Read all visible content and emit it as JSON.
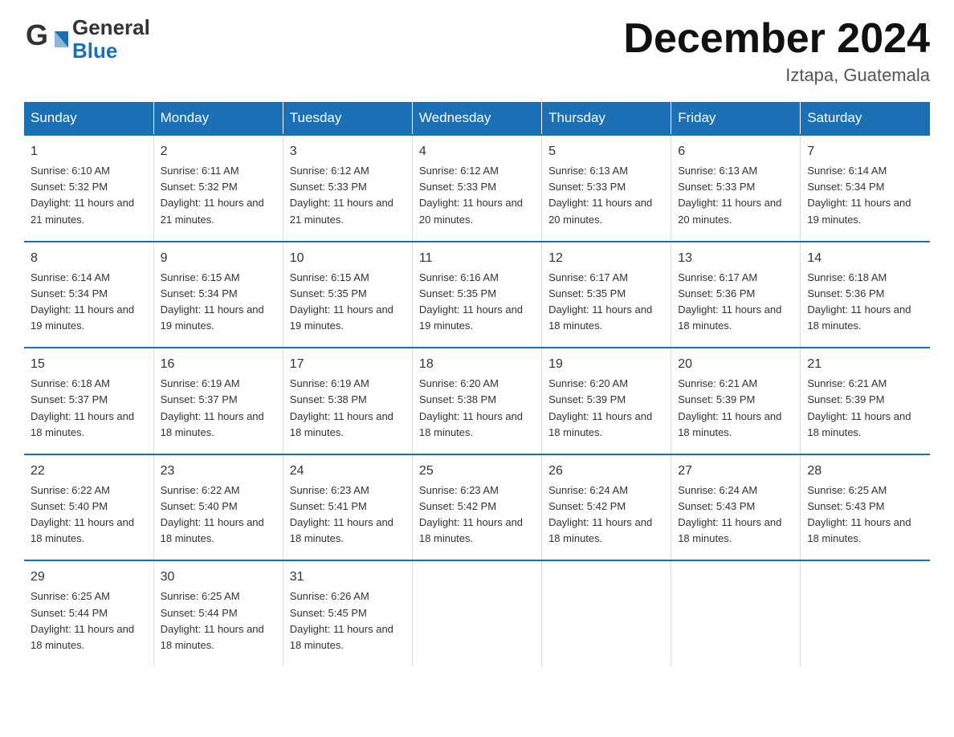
{
  "header": {
    "logo_line1": "General",
    "logo_line2": "Blue",
    "main_title": "December 2024",
    "subtitle": "Iztapa, Guatemala"
  },
  "days_of_week": [
    "Sunday",
    "Monday",
    "Tuesday",
    "Wednesday",
    "Thursday",
    "Friday",
    "Saturday"
  ],
  "weeks": [
    [
      {
        "day": "1",
        "sunrise": "6:10 AM",
        "sunset": "5:32 PM",
        "daylight": "11 hours and 21 minutes."
      },
      {
        "day": "2",
        "sunrise": "6:11 AM",
        "sunset": "5:32 PM",
        "daylight": "11 hours and 21 minutes."
      },
      {
        "day": "3",
        "sunrise": "6:12 AM",
        "sunset": "5:33 PM",
        "daylight": "11 hours and 21 minutes."
      },
      {
        "day": "4",
        "sunrise": "6:12 AM",
        "sunset": "5:33 PM",
        "daylight": "11 hours and 20 minutes."
      },
      {
        "day": "5",
        "sunrise": "6:13 AM",
        "sunset": "5:33 PM",
        "daylight": "11 hours and 20 minutes."
      },
      {
        "day": "6",
        "sunrise": "6:13 AM",
        "sunset": "5:33 PM",
        "daylight": "11 hours and 20 minutes."
      },
      {
        "day": "7",
        "sunrise": "6:14 AM",
        "sunset": "5:34 PM",
        "daylight": "11 hours and 19 minutes."
      }
    ],
    [
      {
        "day": "8",
        "sunrise": "6:14 AM",
        "sunset": "5:34 PM",
        "daylight": "11 hours and 19 minutes."
      },
      {
        "day": "9",
        "sunrise": "6:15 AM",
        "sunset": "5:34 PM",
        "daylight": "11 hours and 19 minutes."
      },
      {
        "day": "10",
        "sunrise": "6:15 AM",
        "sunset": "5:35 PM",
        "daylight": "11 hours and 19 minutes."
      },
      {
        "day": "11",
        "sunrise": "6:16 AM",
        "sunset": "5:35 PM",
        "daylight": "11 hours and 19 minutes."
      },
      {
        "day": "12",
        "sunrise": "6:17 AM",
        "sunset": "5:35 PM",
        "daylight": "11 hours and 18 minutes."
      },
      {
        "day": "13",
        "sunrise": "6:17 AM",
        "sunset": "5:36 PM",
        "daylight": "11 hours and 18 minutes."
      },
      {
        "day": "14",
        "sunrise": "6:18 AM",
        "sunset": "5:36 PM",
        "daylight": "11 hours and 18 minutes."
      }
    ],
    [
      {
        "day": "15",
        "sunrise": "6:18 AM",
        "sunset": "5:37 PM",
        "daylight": "11 hours and 18 minutes."
      },
      {
        "day": "16",
        "sunrise": "6:19 AM",
        "sunset": "5:37 PM",
        "daylight": "11 hours and 18 minutes."
      },
      {
        "day": "17",
        "sunrise": "6:19 AM",
        "sunset": "5:38 PM",
        "daylight": "11 hours and 18 minutes."
      },
      {
        "day": "18",
        "sunrise": "6:20 AM",
        "sunset": "5:38 PM",
        "daylight": "11 hours and 18 minutes."
      },
      {
        "day": "19",
        "sunrise": "6:20 AM",
        "sunset": "5:39 PM",
        "daylight": "11 hours and 18 minutes."
      },
      {
        "day": "20",
        "sunrise": "6:21 AM",
        "sunset": "5:39 PM",
        "daylight": "11 hours and 18 minutes."
      },
      {
        "day": "21",
        "sunrise": "6:21 AM",
        "sunset": "5:39 PM",
        "daylight": "11 hours and 18 minutes."
      }
    ],
    [
      {
        "day": "22",
        "sunrise": "6:22 AM",
        "sunset": "5:40 PM",
        "daylight": "11 hours and 18 minutes."
      },
      {
        "day": "23",
        "sunrise": "6:22 AM",
        "sunset": "5:40 PM",
        "daylight": "11 hours and 18 minutes."
      },
      {
        "day": "24",
        "sunrise": "6:23 AM",
        "sunset": "5:41 PM",
        "daylight": "11 hours and 18 minutes."
      },
      {
        "day": "25",
        "sunrise": "6:23 AM",
        "sunset": "5:42 PM",
        "daylight": "11 hours and 18 minutes."
      },
      {
        "day": "26",
        "sunrise": "6:24 AM",
        "sunset": "5:42 PM",
        "daylight": "11 hours and 18 minutes."
      },
      {
        "day": "27",
        "sunrise": "6:24 AM",
        "sunset": "5:43 PM",
        "daylight": "11 hours and 18 minutes."
      },
      {
        "day": "28",
        "sunrise": "6:25 AM",
        "sunset": "5:43 PM",
        "daylight": "11 hours and 18 minutes."
      }
    ],
    [
      {
        "day": "29",
        "sunrise": "6:25 AM",
        "sunset": "5:44 PM",
        "daylight": "11 hours and 18 minutes."
      },
      {
        "day": "30",
        "sunrise": "6:25 AM",
        "sunset": "5:44 PM",
        "daylight": "11 hours and 18 minutes."
      },
      {
        "day": "31",
        "sunrise": "6:26 AM",
        "sunset": "5:45 PM",
        "daylight": "11 hours and 18 minutes."
      },
      null,
      null,
      null,
      null
    ]
  ]
}
